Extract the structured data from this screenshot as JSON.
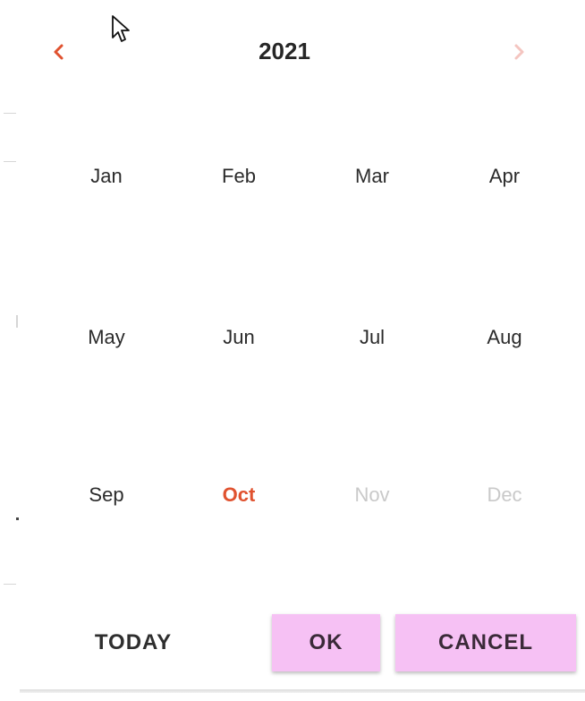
{
  "header": {
    "year": "2021",
    "prev_icon": "chevron-left-icon",
    "next_icon": "chevron-right-icon"
  },
  "months": [
    {
      "label": "Jan",
      "state": "normal"
    },
    {
      "label": "Feb",
      "state": "normal"
    },
    {
      "label": "Mar",
      "state": "normal"
    },
    {
      "label": "Apr",
      "state": "normal"
    },
    {
      "label": "May",
      "state": "normal"
    },
    {
      "label": "Jun",
      "state": "normal"
    },
    {
      "label": "Jul",
      "state": "normal"
    },
    {
      "label": "Aug",
      "state": "normal"
    },
    {
      "label": "Sep",
      "state": "normal"
    },
    {
      "label": "Oct",
      "state": "selected"
    },
    {
      "label": "Nov",
      "state": "disabled"
    },
    {
      "label": "Dec",
      "state": "disabled"
    }
  ],
  "actions": {
    "today_label": "TODAY",
    "ok_label": "OK",
    "cancel_label": "CANCEL"
  },
  "colors": {
    "accent": "#e0522f",
    "button_fill": "#f6c1f4",
    "disabled_text": "#c9c9c9"
  }
}
